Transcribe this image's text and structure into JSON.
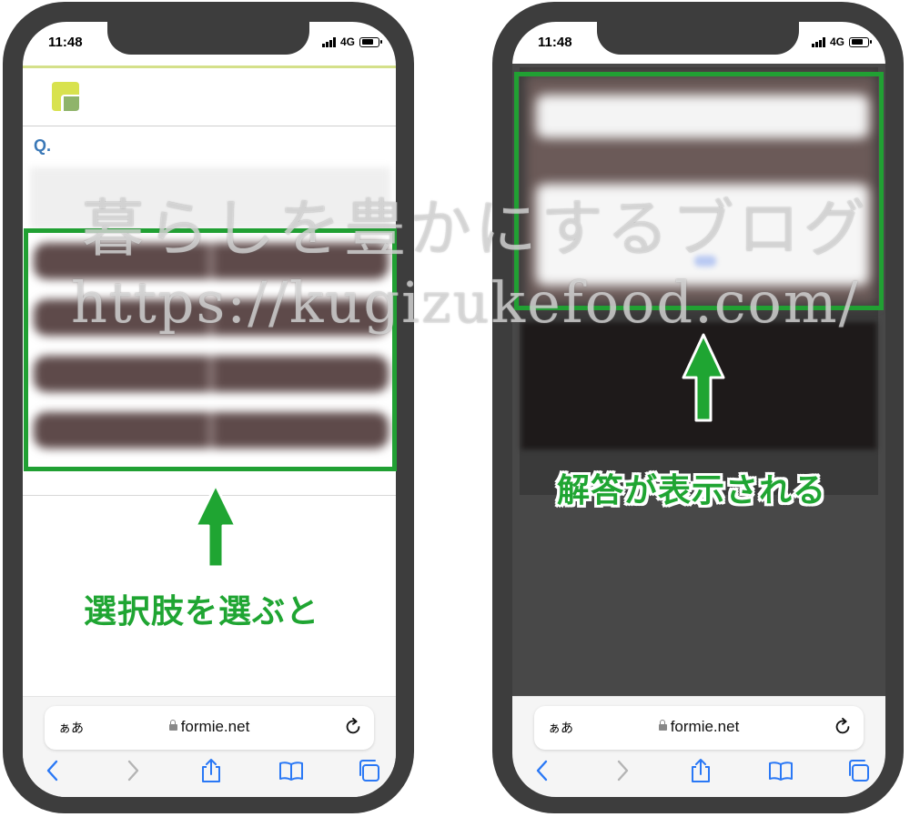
{
  "left_phone": {
    "status": {
      "time": "11:48",
      "network": "4G"
    },
    "question_label": "Q.",
    "annotation": "選択肢を選ぶと",
    "browser": {
      "aa": "ぁあ",
      "url": "formie.net"
    }
  },
  "right_phone": {
    "status": {
      "time": "11:48",
      "network": "4G"
    },
    "annotation": "解答が表示される",
    "browser": {
      "aa": "ぁあ",
      "url": "formie.net"
    }
  },
  "watermark": {
    "line1": "暮らしを豊かにするブログ",
    "line2": "https://kugizukefood.com/"
  },
  "colors": {
    "highlight": "#21a033",
    "annotation": "#1fa532",
    "phone_frame": "#3d3d3d",
    "question": "#3a78b7"
  },
  "icons": [
    "signal-icon",
    "battery-icon",
    "lock-icon",
    "reload-icon",
    "back-icon",
    "forward-icon",
    "share-icon",
    "bookmarks-icon",
    "tabs-icon",
    "up-arrow-icon"
  ]
}
